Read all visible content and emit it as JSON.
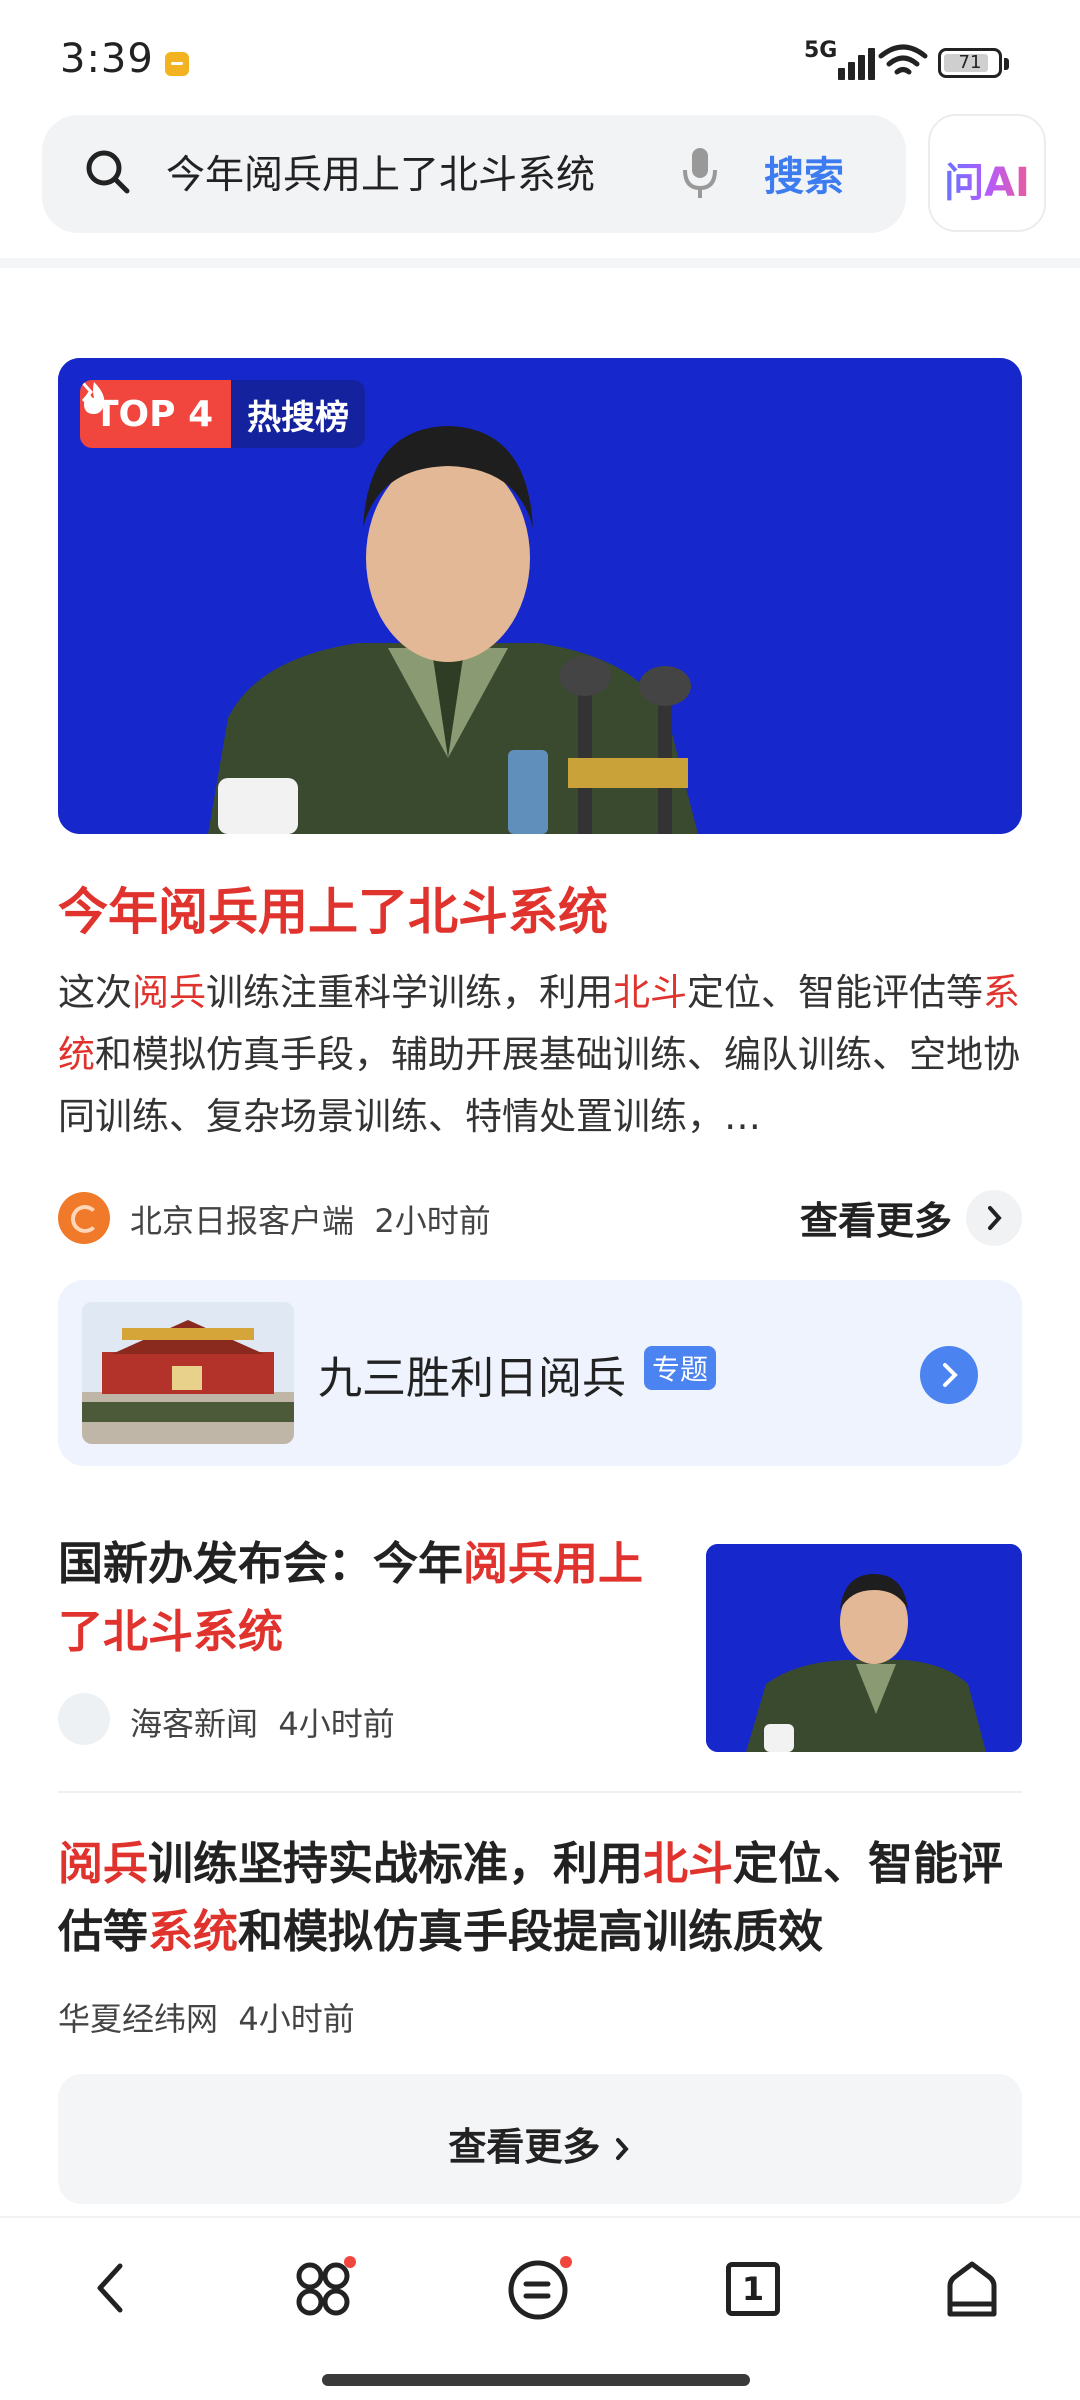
{
  "status_bar": {
    "time": "3:39",
    "network": "5G",
    "battery": "71"
  },
  "search": {
    "query": "今年阅兵用上了北斗系统",
    "button_label": "搜索",
    "ai_label": "问AI",
    "icons": [
      "search-icon",
      "microphone-icon"
    ]
  },
  "hero": {
    "rank_label": "TOP 4",
    "board_label": "热搜榜",
    "icons": [
      "flame-icon",
      "chevron-right-icon"
    ]
  },
  "main_article": {
    "headline": "今年阅兵用上了北斗系统",
    "summary_parts": [
      {
        "t": "这次",
        "h": false
      },
      {
        "t": "阅兵",
        "h": true
      },
      {
        "t": "训练注重科学训练，利用",
        "h": false
      },
      {
        "t": "北斗",
        "h": true
      },
      {
        "t": "定位、智能评估等",
        "h": false
      },
      {
        "t": "系统",
        "h": true
      },
      {
        "t": "和模拟仿真手段，辅助开展基础训练、编队训练、空地协同训练、复杂场景训练、特情处置训练，…",
        "h": false
      }
    ],
    "source": "北京日报客户端",
    "time_ago": "2小时前",
    "more_label": "查看更多"
  },
  "topic_card": {
    "title": "九三胜利日阅兵",
    "tag": "专题"
  },
  "article2": {
    "title_plain": "国新办发布会：今年",
    "title_highlight": "阅兵用上了北斗系统",
    "source": "海客新闻",
    "time_ago": "4小时前"
  },
  "article3": {
    "title_parts": [
      {
        "t": "阅兵",
        "h": true
      },
      {
        "t": "训练坚持实战标准，利用",
        "h": false
      },
      {
        "t": "北斗",
        "h": true
      },
      {
        "t": "定位、智能评估等",
        "h": false
      },
      {
        "t": "系统",
        "h": true
      },
      {
        "t": "和模拟仿真手段提高训练质效",
        "h": false
      }
    ],
    "source": "华夏经纬网",
    "time_ago": "4小时前"
  },
  "more_button": {
    "label": "查看更多"
  },
  "bottom_nav": {
    "items": [
      "back-icon",
      "apps-icon",
      "message-icon",
      "tabs-icon",
      "home-icon"
    ],
    "tab_count": "1"
  },
  "colors": {
    "accent_blue": "#3d7cf0",
    "highlight_red": "#e0332d",
    "hero_background": "#1526c8"
  }
}
